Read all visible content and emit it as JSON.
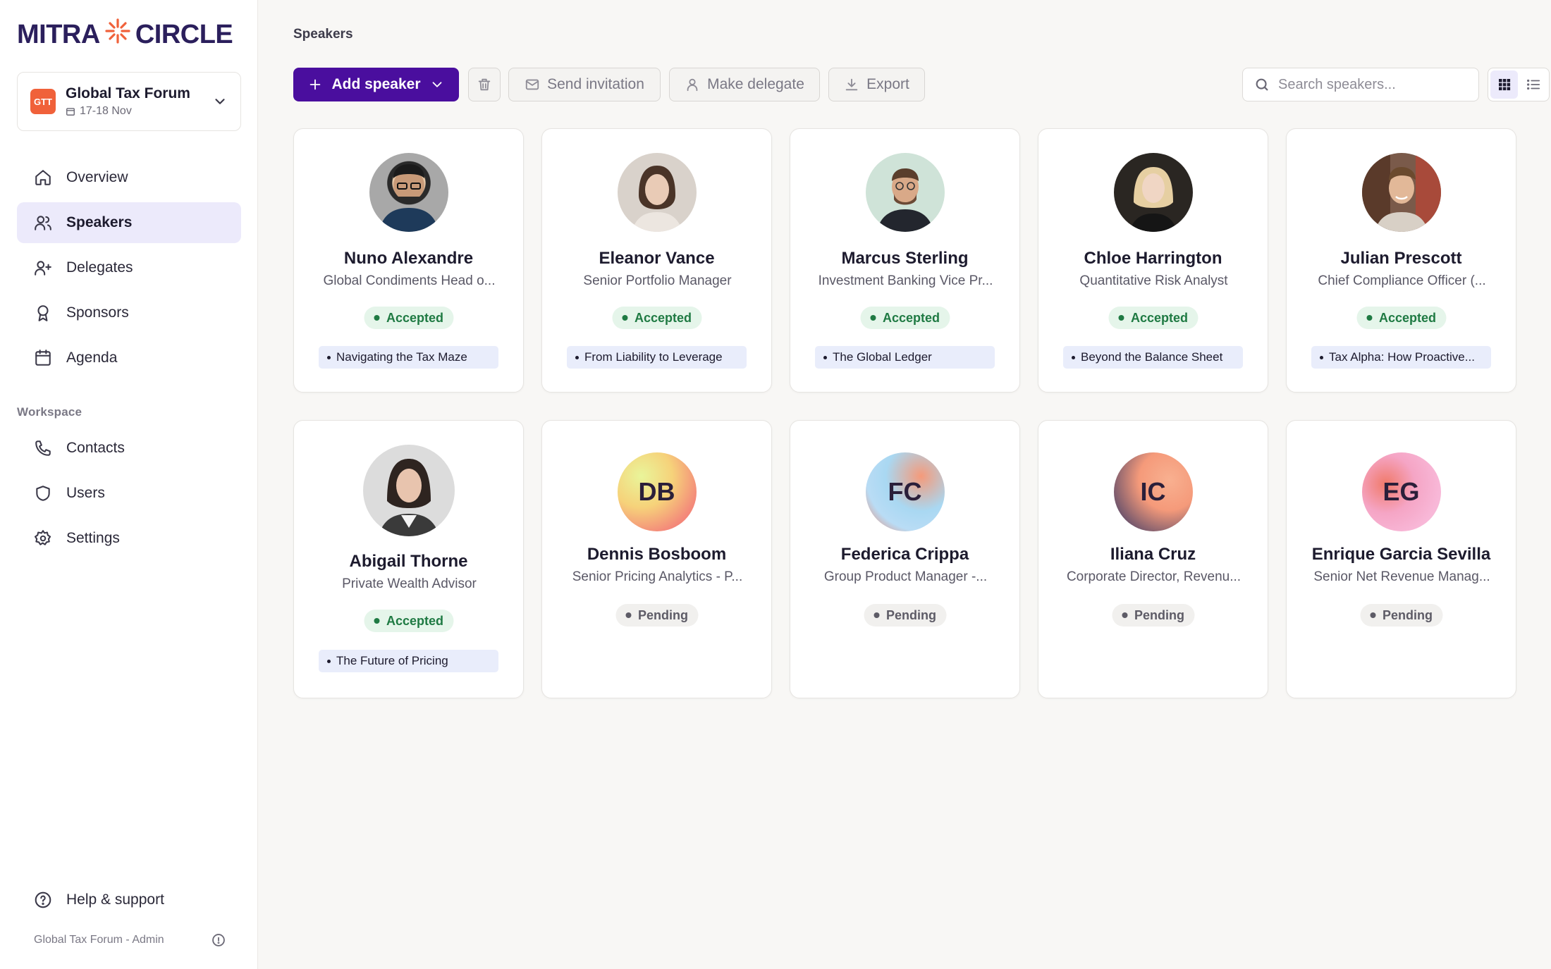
{
  "brand": {
    "left": "MITRA",
    "right": "CIRCLE"
  },
  "event": {
    "badge": "GTT",
    "name": "Global Tax Forum",
    "date": "17-18 Nov"
  },
  "nav": [
    {
      "label": "Overview",
      "icon": "home-icon"
    },
    {
      "label": "Speakers",
      "icon": "users-icon",
      "active": true
    },
    {
      "label": "Delegates",
      "icon": "user-plus-icon"
    },
    {
      "label": "Sponsors",
      "icon": "award-icon"
    },
    {
      "label": "Agenda",
      "icon": "calendar-icon"
    }
  ],
  "workspace": {
    "label": "Workspace",
    "items": [
      {
        "label": "Contacts",
        "icon": "phone-icon"
      },
      {
        "label": "Users",
        "icon": "shield-icon"
      },
      {
        "label": "Settings",
        "icon": "gear-icon"
      }
    ]
  },
  "help": {
    "label": "Help & support"
  },
  "footer": {
    "text": "Global Tax Forum - Admin"
  },
  "page": {
    "title": "Speakers"
  },
  "toolbar": {
    "add": "Add speaker",
    "send": "Send invitation",
    "delegate": "Make delegate",
    "export": "Export",
    "search_placeholder": "Search speakers..."
  },
  "colors": {
    "primary": "#4a0e9e",
    "accepted": "#1f7a43",
    "accent_orange": "#f0613a"
  },
  "speakers": [
    {
      "name": "Nuno Alexandre",
      "role": "Global Condiments Head o...",
      "status": "Accepted",
      "session": "Navigating the Tax Maze"
    },
    {
      "name": "Eleanor Vance",
      "role": "Senior Portfolio Manager",
      "status": "Accepted",
      "session": "From Liability to Leverage"
    },
    {
      "name": "Marcus Sterling",
      "role": "Investment Banking Vice Pr...",
      "status": "Accepted",
      "session": "The Global Ledger"
    },
    {
      "name": "Chloe Harrington",
      "role": "Quantitative Risk Analyst",
      "status": "Accepted",
      "session": "Beyond the Balance Sheet"
    },
    {
      "name": "Julian Prescott",
      "role": "Chief Compliance Officer (...",
      "status": "Accepted",
      "session": "Tax Alpha: How Proactive..."
    },
    {
      "name": "Abigail Thorne",
      "role": "Private Wealth Advisor",
      "status": "Accepted",
      "session": "The Future of Pricing"
    },
    {
      "name": "Dennis Bosboom",
      "initials": "DB",
      "role": "Senior Pricing Analytics - P...",
      "status": "Pending"
    },
    {
      "name": "Federica Crippa",
      "initials": "FC",
      "role": "Group Product Manager -...",
      "status": "Pending"
    },
    {
      "name": "Iliana Cruz",
      "initials": "IC",
      "role": "Corporate Director, Revenu...",
      "status": "Pending"
    },
    {
      "name": "Enrique Garcia Sevilla",
      "initials": "EG",
      "role": "Senior Net Revenue Manag...",
      "status": "Pending"
    }
  ]
}
